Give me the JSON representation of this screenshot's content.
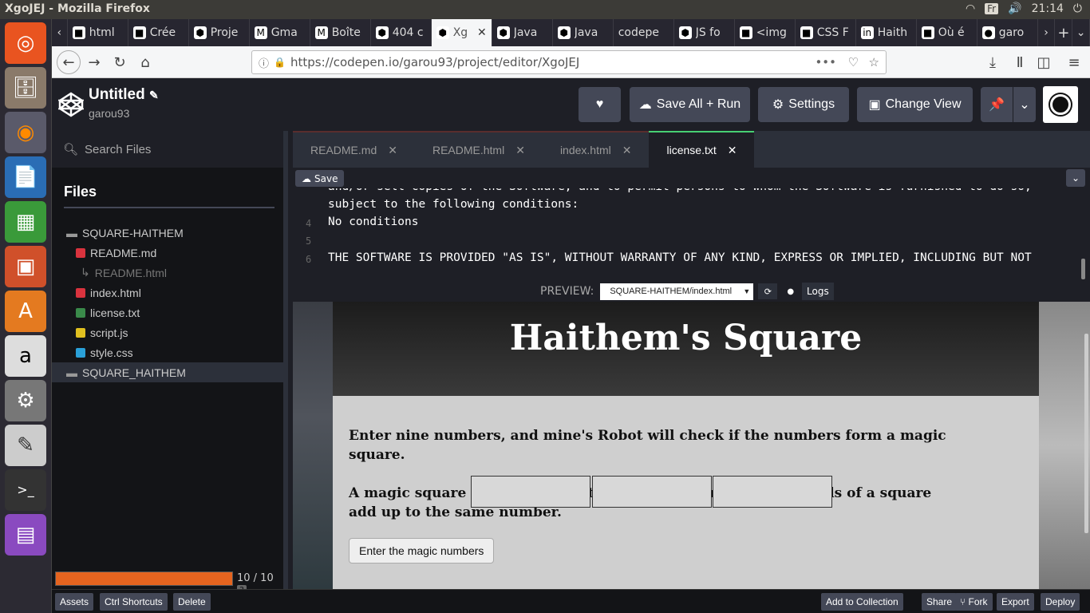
{
  "os": {
    "window_title": "XgoJEJ - Mozilla Firefox",
    "lang": "Fr",
    "clock": "21:14"
  },
  "launcher": [
    "ubuntu-icon",
    "files-icon",
    "firefox-icon",
    "writer-icon",
    "calc-icon",
    "impress-icon",
    "software-icon",
    "amazon-icon",
    "settings-icon",
    "text-editor-icon",
    "terminal-icon",
    "stack-icon"
  ],
  "browser_tabs": [
    {
      "label": "html",
      "icon": "tab-icon"
    },
    {
      "label": "Crée",
      "icon": "tab-icon"
    },
    {
      "label": "Proje",
      "icon": "codepen-icon"
    },
    {
      "label": "Gma",
      "icon": "gmail-icon"
    },
    {
      "label": "Boîte",
      "icon": "gmail-icon"
    },
    {
      "label": "404 c",
      "icon": "codepen-icon"
    },
    {
      "label": "Xg",
      "icon": "codepen-icon",
      "active": true
    },
    {
      "label": "Java",
      "icon": "codepen-icon"
    },
    {
      "label": "Java",
      "icon": "codepen-icon"
    },
    {
      "label": "codepe",
      "icon": ""
    },
    {
      "label": "JS fo",
      "icon": "codepen-icon"
    },
    {
      "label": "<img",
      "icon": "tab-icon"
    },
    {
      "label": "CSS F",
      "icon": "tab-icon"
    },
    {
      "label": "Haith",
      "icon": "linkedin-icon"
    },
    {
      "label": "Où é",
      "icon": "tab-icon"
    },
    {
      "label": "garo",
      "icon": "github-icon"
    }
  ],
  "url": "https://codepen.io/garou93/project/editor/XgoJEJ",
  "project": {
    "title": "Untitled",
    "user": "garou93"
  },
  "header_buttons": {
    "save": "Save All + Run",
    "settings": "Settings",
    "change_view": "Change View"
  },
  "sidebar": {
    "search_placeholder": "Search Files",
    "files_heading": "Files",
    "tree": [
      {
        "label": "SQUARE-HAITHEM",
        "type": "folder",
        "indent": 0
      },
      {
        "label": "README.md",
        "type": "md",
        "indent": 1
      },
      {
        "label": "README.html",
        "type": "derived",
        "indent": 2
      },
      {
        "label": "index.html",
        "type": "html",
        "indent": 1
      },
      {
        "label": "license.txt",
        "type": "txt",
        "indent": 1
      },
      {
        "label": "script.js",
        "type": "js",
        "indent": 1
      },
      {
        "label": "style.css",
        "type": "css",
        "indent": 1
      },
      {
        "label": "SQUARE_HAITHEM",
        "type": "folder",
        "indent": 0,
        "selected": true
      }
    ],
    "progress_label": "10 / 10",
    "progress_fraction": 1.0
  },
  "editor_tabs": [
    "README.md",
    "README.html",
    "index.html",
    "license.txt"
  ],
  "editor_active_tab": "license.txt",
  "editor_save": "Save",
  "code_lines": [
    {
      "num": "",
      "text": "and/or sell copies of the Software, and to permit persons to whom the Software is furnished to do so,"
    },
    {
      "num": "",
      "text": "subject to the following conditions:"
    },
    {
      "num": "4",
      "text": "No conditions"
    },
    {
      "num": "5",
      "text": ""
    },
    {
      "num": "6",
      "text": "THE SOFTWARE IS PROVIDED \"AS IS\", WITHOUT WARRANTY OF ANY KIND, EXPRESS OR IMPLIED, INCLUDING BUT NOT"
    }
  ],
  "preview": {
    "label": "PREVIEW:",
    "file": "SQUARE-HAITHEM/index.html",
    "logs": "Logs",
    "heading": "Haithem's Square",
    "p1": "Enter nine numbers, and mine's Robot will check if the numbers form a magic square.",
    "p2": "A magic square exists when all the rows, columns, and diagonals of a square add up to the same number.",
    "button": "Enter the magic numbers"
  },
  "footer": {
    "left": [
      "Assets",
      "Ctrl Shortcuts",
      "Delete"
    ],
    "right": [
      "Add to Collection",
      "Share",
      "Fork",
      "Export",
      "Deploy"
    ]
  }
}
